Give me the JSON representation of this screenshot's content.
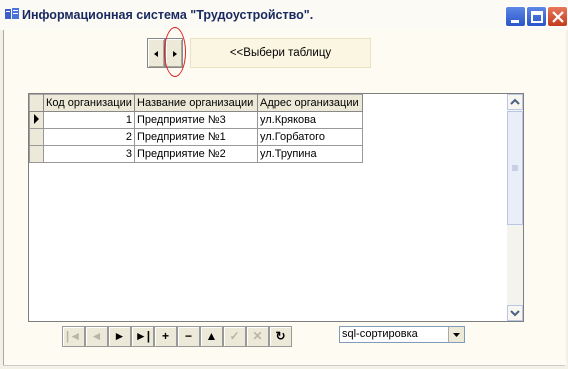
{
  "window": {
    "title": "Информационная система \"Трудоустройство\"."
  },
  "table_picker": {
    "hint": "<<Выбери таблицу"
  },
  "grid": {
    "columns": [
      "Код организации",
      "Название организации",
      "Адрес организации"
    ],
    "rows": [
      {
        "code": "1",
        "name": "Предприятие №3",
        "address": "ул.Крякова"
      },
      {
        "code": "2",
        "name": "Предприятие №1",
        "address": "ул.Горбатого"
      },
      {
        "code": "3",
        "name": "Предприятие №2",
        "address": "ул.Трупина"
      }
    ]
  },
  "navigator": {
    "buttons": [
      {
        "name": "first-record-button",
        "glyph": "|◄",
        "enabled": false
      },
      {
        "name": "prior-record-button",
        "glyph": "◄",
        "enabled": false
      },
      {
        "name": "next-record-button",
        "glyph": "►",
        "enabled": true
      },
      {
        "name": "last-record-button",
        "glyph": "►|",
        "enabled": true
      },
      {
        "name": "insert-record-button",
        "glyph": "+",
        "enabled": true
      },
      {
        "name": "delete-record-button",
        "glyph": "−",
        "enabled": true
      },
      {
        "name": "edit-record-button",
        "glyph": "▲",
        "enabled": true
      },
      {
        "name": "post-record-button",
        "glyph": "✓",
        "enabled": false
      },
      {
        "name": "cancel-edit-button",
        "glyph": "✕",
        "enabled": false
      },
      {
        "name": "refresh-button",
        "glyph": "↻",
        "enabled": true
      }
    ]
  },
  "sort": {
    "selected": "sql-сортировка"
  }
}
